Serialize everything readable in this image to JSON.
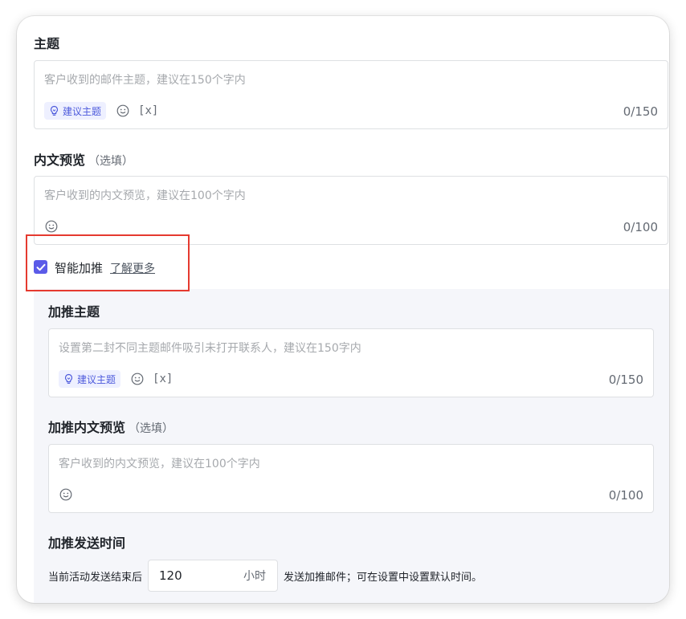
{
  "subject": {
    "title": "主题",
    "placeholder": "客户收到的邮件主题，建议在150个字内",
    "suggest_label": "建议主题",
    "variable_label": "[x]",
    "counter": "0/150"
  },
  "preview": {
    "title": "内文预览",
    "optional": "（选填）",
    "placeholder": "客户收到的内文预览，建议在100个字内",
    "counter": "0/100"
  },
  "smart_boost": {
    "checked": true,
    "label": "智能加推",
    "learn_more": "了解更多"
  },
  "boost_subject": {
    "title": "加推主题",
    "placeholder": "设置第二封不同主题邮件吸引未打开联系人，建议在150字内",
    "suggest_label": "建议主题",
    "variable_label": "[x]",
    "counter": "0/150"
  },
  "boost_preview": {
    "title": "加推内文预览",
    "optional": "（选填）",
    "placeholder": "客户收到的内文预览，建议在100个字内",
    "counter": "0/100"
  },
  "send_time": {
    "title": "加推发送时间",
    "prefix": "当前活动发送结束后",
    "value": "120",
    "unit": "小时",
    "suffix": "发送加推邮件；可在设置中设置默认时间。"
  },
  "icons": {
    "suggest": "lightbulb-icon",
    "emoji": "smiley-icon",
    "checkbox": "check-icon"
  },
  "colors": {
    "accent": "#5b5be8",
    "suggest_text": "#4e5bdc",
    "suggest_bg": "#eef0ff",
    "highlight": "#e53a2f",
    "panel_bg": "#f5f6fa"
  }
}
